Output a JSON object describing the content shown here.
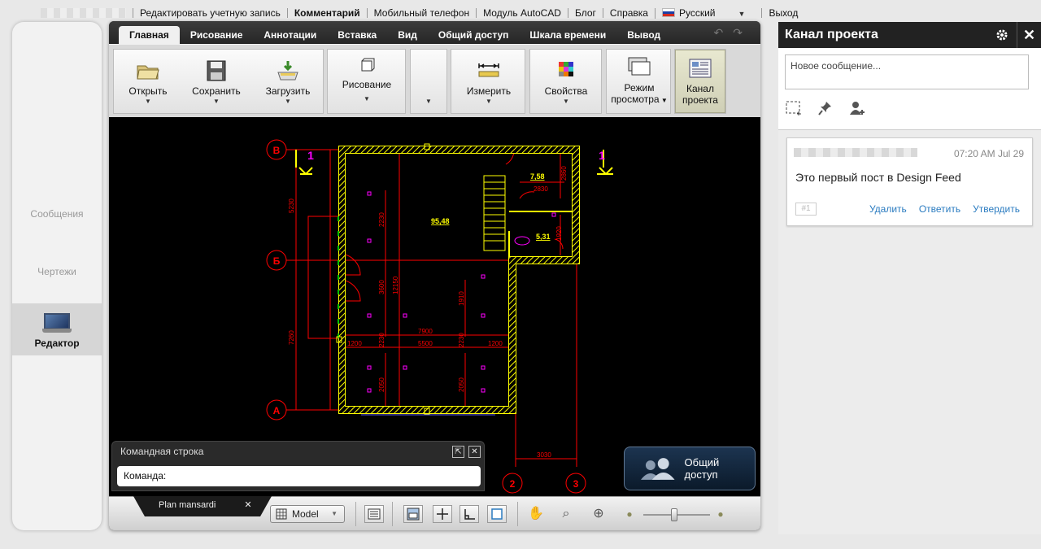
{
  "topbar": {
    "links": [
      "Редактировать учетную запись",
      "Комментарий",
      "Мобильный телефон",
      "Модуль AutoCAD",
      "Блог",
      "Справка"
    ],
    "language": "Русский",
    "logout": "Выход"
  },
  "sidebar": {
    "items": [
      {
        "label": "Сообщения"
      },
      {
        "label": "Чертежи"
      },
      {
        "label": "Редактор"
      }
    ]
  },
  "ribbon": {
    "tabs": [
      "Главная",
      "Рисование",
      "Аннотации",
      "Вставка",
      "Вид",
      "Общий доступ",
      "Шкала времени",
      "Вывод"
    ],
    "buttons": {
      "open": "Открыть",
      "save": "Сохранить",
      "upload": "Загрузить",
      "draw": "Рисование",
      "measure": "Измерить",
      "properties": "Свойства",
      "view_mode_1": "Режим",
      "view_mode_2": "просмотра",
      "feed_1": "Канал",
      "feed_2": "проекта"
    }
  },
  "drawing": {
    "axes": [
      "В",
      "Б",
      "А",
      "2",
      "3"
    ],
    "section": "1",
    "dims": [
      "5230",
      "7260",
      "2230",
      "3600",
      "12150",
      "2230",
      "2050",
      "1910",
      "2230",
      "2050",
      "7900",
      "5500",
      "1200",
      "1200",
      "2830",
      "2860",
      "1920",
      "3030"
    ],
    "areas": [
      "95,48",
      "7,58",
      "5,31"
    ]
  },
  "command": {
    "title": "Командная строка",
    "prompt": "Команда:"
  },
  "share_button": "Общий доступ",
  "bottombar": {
    "sheet": "Plan mansardi",
    "model": "Model"
  },
  "feed": {
    "title": "Канал проекта",
    "placeholder": "Новое сообщение...",
    "post": {
      "time": "07:20 AM Jul 29",
      "text": "Это первый пост в Design Feed",
      "tag": "#1",
      "actions": [
        "Удалить",
        "Ответить",
        "Утвердить"
      ]
    }
  },
  "colors": {
    "wall": "#ffff00",
    "dim": "#ff0000",
    "link": "#2a7bc0"
  }
}
